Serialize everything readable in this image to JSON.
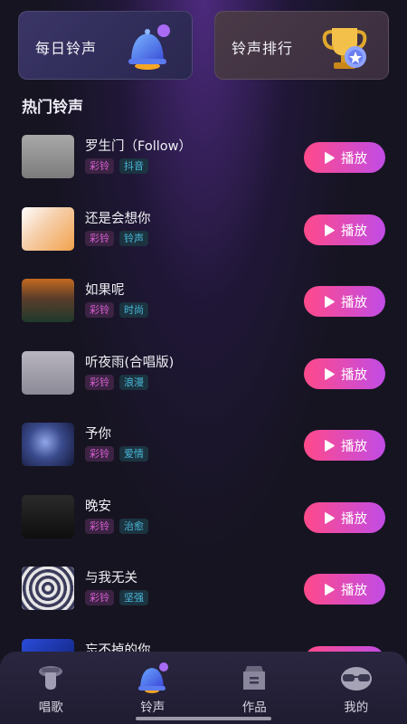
{
  "top_cards": {
    "daily": {
      "label": "每日铃声",
      "icon": "bell-icon"
    },
    "rank": {
      "label": "铃声排行",
      "icon": "trophy-icon"
    }
  },
  "section_title": "热门铃声",
  "play_label": "播放",
  "songs": [
    {
      "title": "罗生门（Follow）",
      "tags": [
        "彩铃",
        "抖音"
      ]
    },
    {
      "title": "还是会想你",
      "tags": [
        "彩铃",
        "铃声"
      ]
    },
    {
      "title": "如果呢",
      "tags": [
        "彩铃",
        "时尚"
      ]
    },
    {
      "title": "听夜雨(合唱版)",
      "tags": [
        "彩铃",
        "浪漫"
      ]
    },
    {
      "title": "予你",
      "tags": [
        "彩铃",
        "爱情"
      ]
    },
    {
      "title": "晚安",
      "tags": [
        "彩铃",
        "治愈"
      ]
    },
    {
      "title": "与我无关",
      "tags": [
        "彩铃",
        "坚强"
      ]
    },
    {
      "title": "忘不掉的你",
      "tags": []
    }
  ],
  "tabs": [
    {
      "label": "唱歌",
      "icon": "microphone-icon",
      "active": false
    },
    {
      "label": "铃声",
      "icon": "bell-icon",
      "active": true
    },
    {
      "label": "作品",
      "icon": "folder-icon",
      "active": false
    },
    {
      "label": "我的",
      "icon": "avatar-glasses-icon",
      "active": false
    }
  ],
  "colors": {
    "accent_start": "#ff4a8a",
    "accent_end": "#c14ce6",
    "tag_pink": "#d75fd1",
    "tag_blue": "#49b8d9"
  }
}
